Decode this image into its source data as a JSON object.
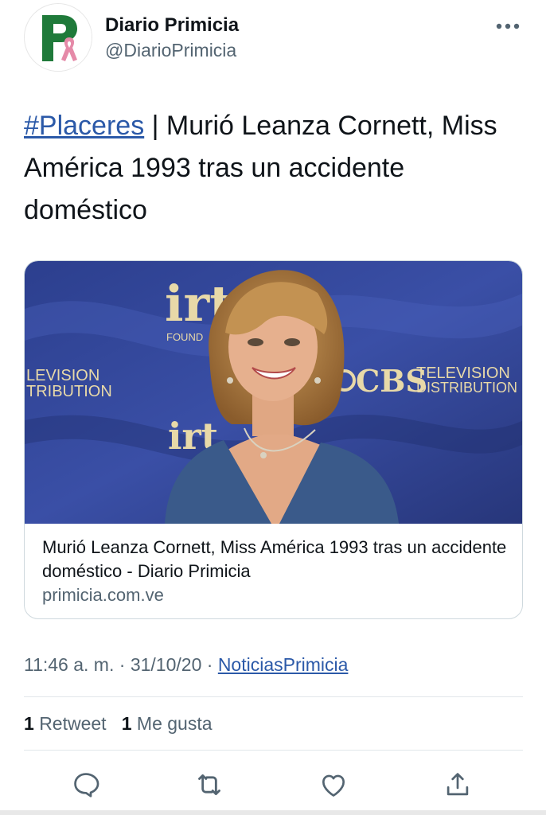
{
  "author": {
    "name": "Diario Primicia",
    "handle": "@DiarioPrimicia",
    "avatar_letter": "P"
  },
  "tweet": {
    "hashtag": "#Placeres",
    "text_after_hashtag": " | Murió Leanza Cornett, Miss América 1993 tras un accidente doméstico"
  },
  "card": {
    "title": "Murió Leanza Cornett, Miss América 1993 tras un accidente doméstico - Diario Primicia",
    "domain": "primicia.com.ve",
    "backdrop_text_left_line1": "LEVISION",
    "backdrop_text_left_line2": "TRIBUTION",
    "backdrop_text_cbs": "CBS",
    "backdrop_text_right_line1": "TELEVISION",
    "backdrop_text_right_line2": "DISTRIBUTION",
    "backdrop_text_top": "irt",
    "backdrop_text_found": "FOUND"
  },
  "meta": {
    "time": "11:46 a. m.",
    "sep1": " · ",
    "date": "31/10/20",
    "sep2": " · ",
    "source": "NoticiasPrimicia"
  },
  "stats": {
    "retweets_count": "1",
    "retweets_label": "Retweet",
    "likes_count": "1",
    "likes_label": "Me gusta"
  },
  "colors": {
    "link": "#2b59a8",
    "muted": "#536471",
    "text": "#0f1419",
    "brand_green": "#1f7a3a",
    "ribbon_pink": "#e58aa8"
  },
  "icons": {
    "more": "more-horizontal-icon",
    "reply": "reply-icon",
    "retweet": "retweet-icon",
    "like": "heart-icon",
    "share": "share-icon"
  }
}
